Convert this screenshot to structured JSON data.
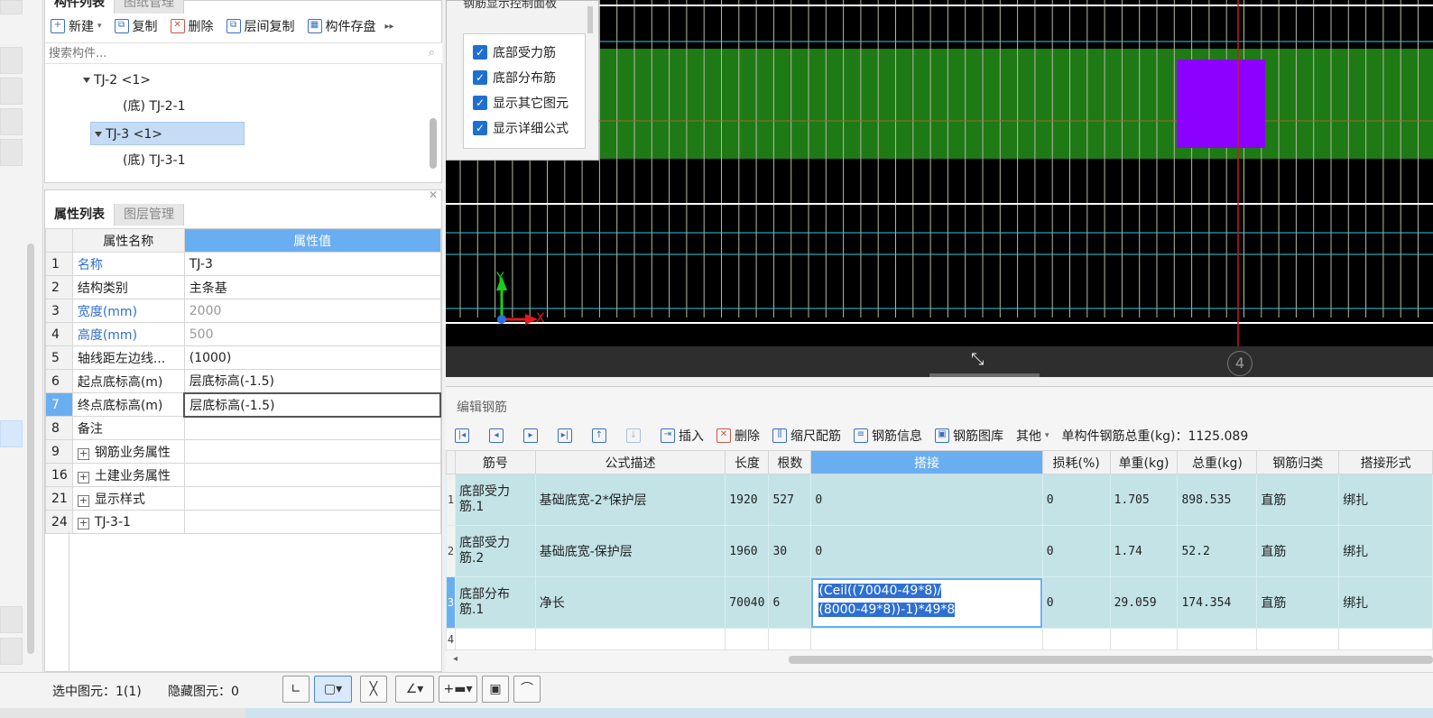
{
  "component_panel": {
    "tabs": [
      "构件列表",
      "图纸管理"
    ],
    "toolbar": {
      "new": "新建",
      "copy": "复制",
      "delete": "删除",
      "floor_copy": "层间复制",
      "save": "构件存盘"
    },
    "search_placeholder": "搜索构件...",
    "tree": [
      {
        "label": "TJ-2 <1>"
      },
      {
        "label": "(底) TJ-2-1"
      },
      {
        "label": "TJ-3 <1>",
        "selected": true
      },
      {
        "label": "(底) TJ-3-1"
      }
    ]
  },
  "property_panel": {
    "tabs": [
      "属性列表",
      "图层管理"
    ],
    "headers": {
      "name": "属性名称",
      "value": "属性值"
    },
    "rows": [
      {
        "num": "1",
        "name": "名称",
        "value": "TJ-3"
      },
      {
        "num": "2",
        "name": "结构类别",
        "value": "主条基"
      },
      {
        "num": "3",
        "name": "宽度(mm)",
        "value": "2000"
      },
      {
        "num": "4",
        "name": "高度(mm)",
        "value": "500"
      },
      {
        "num": "5",
        "name": "轴线距左边线...",
        "value": "(1000)"
      },
      {
        "num": "6",
        "name": "起点底标高(m)",
        "value": "层底标高(-1.5)"
      },
      {
        "num": "7",
        "name": "终点底标高(m)",
        "value": "层底标高(-1.5)"
      },
      {
        "num": "8",
        "name": "备注",
        "value": ""
      },
      {
        "num": "9",
        "name": "钢筋业务属性",
        "value": ""
      },
      {
        "num": "16",
        "name": "土建业务属性",
        "value": ""
      },
      {
        "num": "21",
        "name": "显示样式",
        "value": ""
      },
      {
        "num": "24",
        "name": "TJ-3-1",
        "value": ""
      }
    ]
  },
  "rebar_display_panel": {
    "title": "钢筋显示控制面板",
    "options": [
      {
        "label": "底部受力筋",
        "checked": true
      },
      {
        "label": "底部分布筋",
        "checked": true
      },
      {
        "label": "显示其它图元",
        "checked": true
      },
      {
        "label": "显示详细公式",
        "checked": true
      }
    ]
  },
  "canvas": {
    "axis_number": "4",
    "axis_y": "Y",
    "axis_x": "X"
  },
  "rebar_editor": {
    "title": "编辑钢筋",
    "toolbar": {
      "insert": "插入",
      "delete": "删除",
      "scale_rebar": "缩尺配筋",
      "rebar_info": "钢筋信息",
      "rebar_library": "钢筋图库",
      "other": "其他",
      "total_weight": "单构件钢筋总重(kg)：1125.089"
    },
    "columns": [
      "筋号",
      "公式描述",
      "长度",
      "根数",
      "搭接",
      "损耗(%)",
      "单重(kg)",
      "总重(kg)",
      "钢筋归类",
      "搭接形式"
    ],
    "rows": [
      {
        "num": "1",
        "code": "底部受力筋.1",
        "formula": "基础底宽-2*保护层",
        "length": "1920",
        "count": "527",
        "lap": "0",
        "loss": "0",
        "unit_weight": "1.705",
        "total_weight": "898.535",
        "category": "直筋",
        "lap_type": "绑扎"
      },
      {
        "num": "2",
        "code": "底部受力筋.2",
        "formula": "基础底宽-保护层",
        "length": "1960",
        "count": "30",
        "lap": "0",
        "loss": "0",
        "unit_weight": "1.74",
        "total_weight": "52.2",
        "category": "直筋",
        "lap_type": "绑扎"
      },
      {
        "num": "3",
        "code": "底部分布筋.1",
        "formula": "净长",
        "length": "70040",
        "count": "6",
        "lap": "(Ceil((70040-49*8)/(8000-49*8))-1)*49*8",
        "lap_line1": "(Ceil((70040-49*8)/",
        "lap_line2": "(8000-49*8))-1)*49*8",
        "loss": "0",
        "unit_weight": "29.059",
        "total_weight": "174.354",
        "category": "直筋",
        "lap_type": "绑扎"
      },
      {
        "num": "4"
      }
    ]
  },
  "status_bar": {
    "selected": "选中图元：1(1)",
    "hidden": "隐藏图元：0"
  },
  "colors": {
    "canvas_bg": "#000000",
    "footing_green": "#1e7a14",
    "purple_block": "#8c00ff",
    "selection_blue": "#6aaef2",
    "row_teal": "#c3e3e6"
  }
}
